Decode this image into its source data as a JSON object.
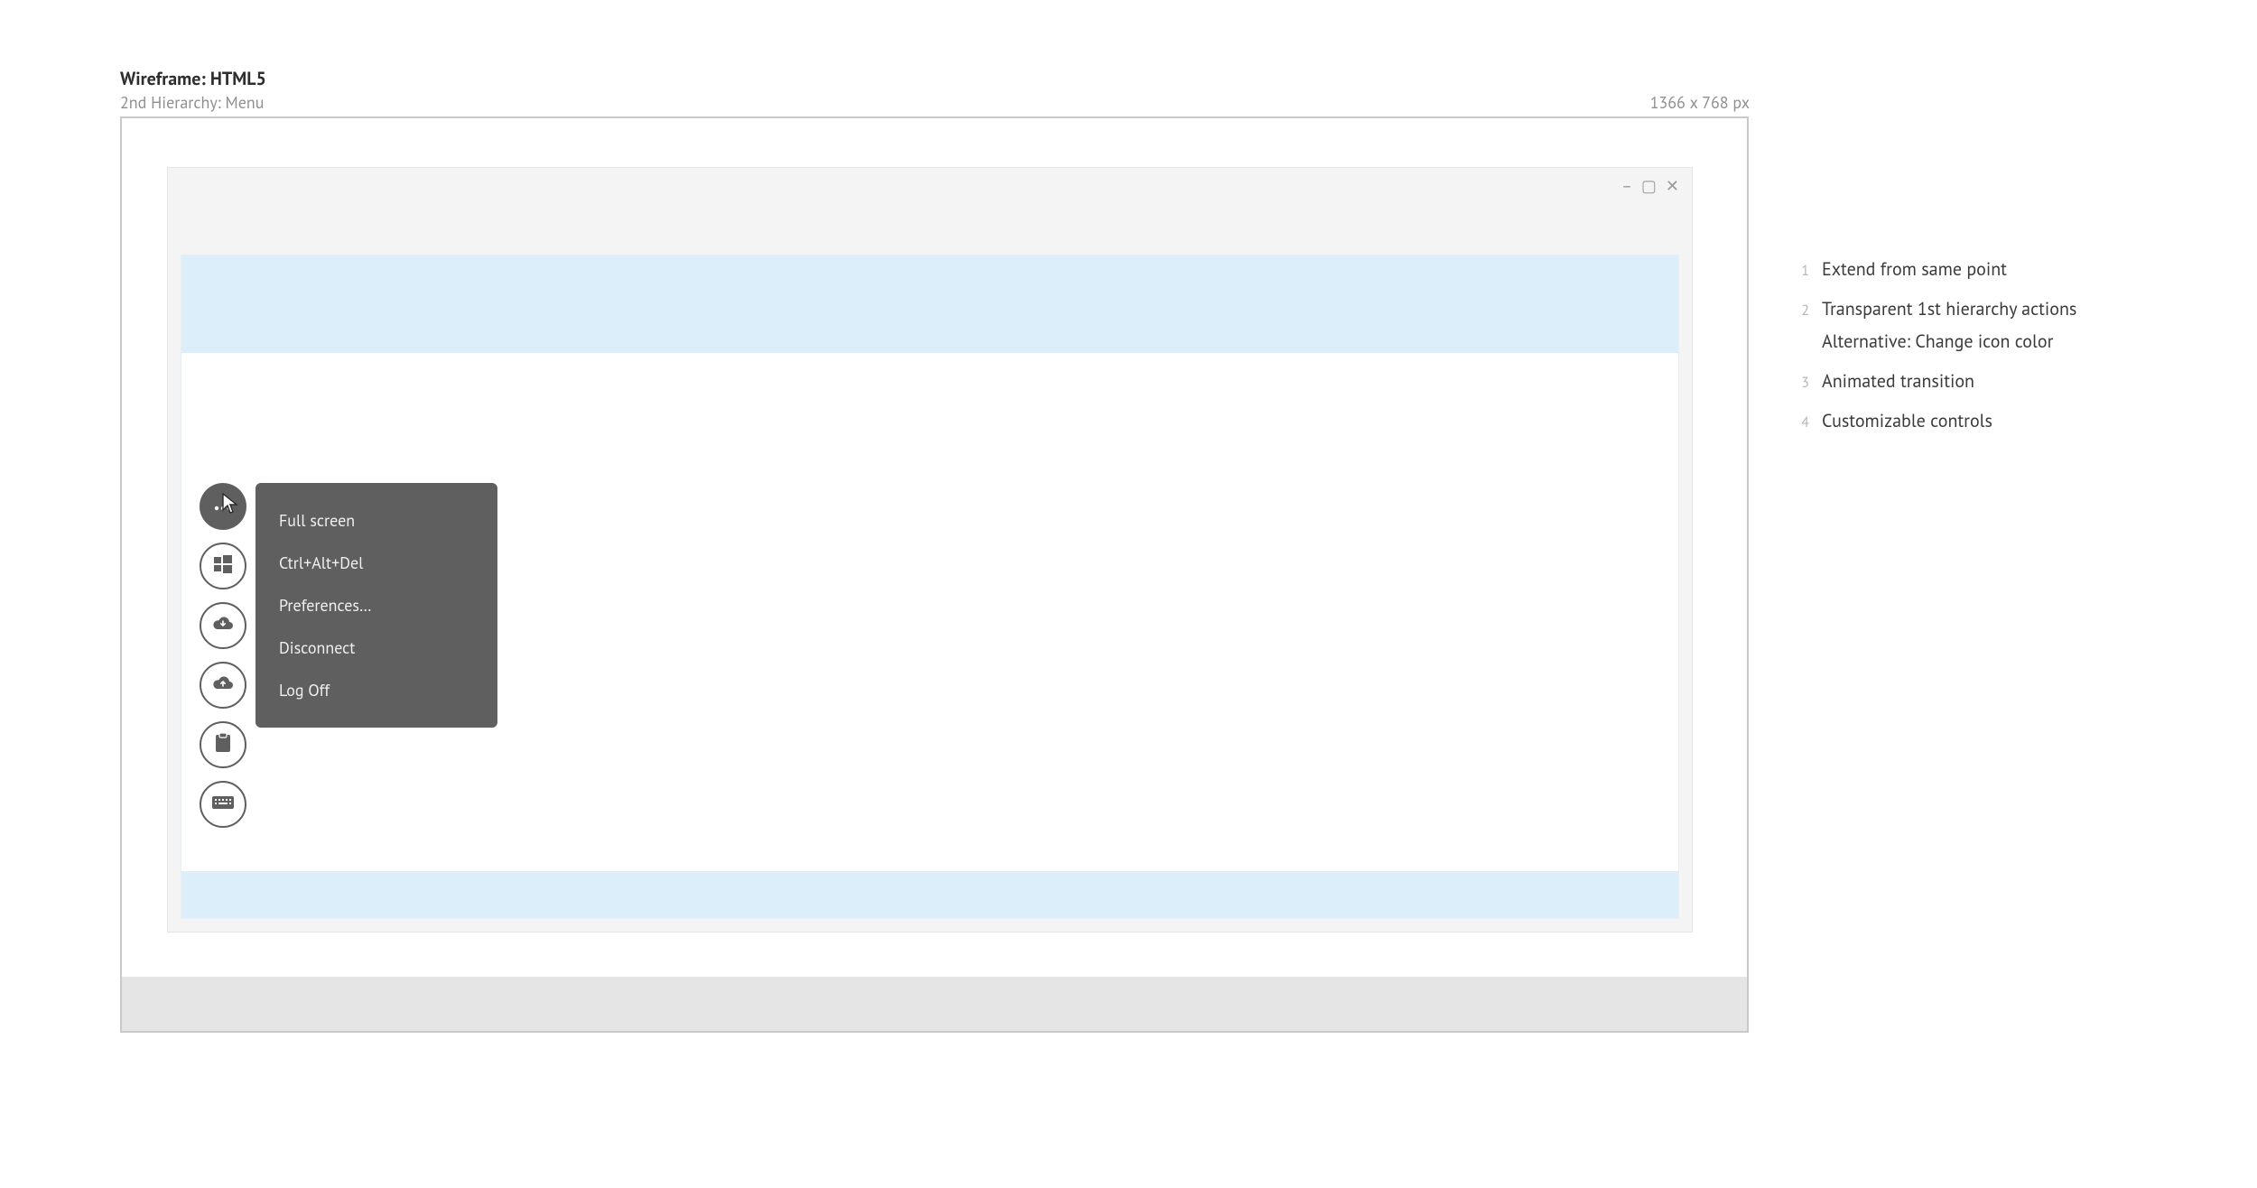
{
  "header": {
    "title": "Wireframe: HTML5",
    "subtitle": "2nd Hierarchy: Menu",
    "dimensions": "1366 x 768 px"
  },
  "window": {
    "controls": {
      "minimize": "–",
      "maximize": "▢",
      "close": "✕"
    }
  },
  "actions": [
    {
      "name": "more-icon"
    },
    {
      "name": "windows-icon"
    },
    {
      "name": "download-icon"
    },
    {
      "name": "upload-icon"
    },
    {
      "name": "clipboard-icon"
    },
    {
      "name": "keyboard-icon"
    }
  ],
  "menu": {
    "items": [
      {
        "label": "Full screen"
      },
      {
        "label": "Ctrl+Alt+Del"
      },
      {
        "label": "Preferences…"
      },
      {
        "label": "Disconnect"
      },
      {
        "label": "Log Off"
      }
    ]
  },
  "notes": [
    {
      "num": "1",
      "text": "Extend from same point"
    },
    {
      "num": "2",
      "text": "Transparent 1st hierarchy actions",
      "sub": "Alternative: Change icon color"
    },
    {
      "num": "3",
      "text": "Animated transition"
    },
    {
      "num": "4",
      "text": "Customizable controls"
    }
  ]
}
